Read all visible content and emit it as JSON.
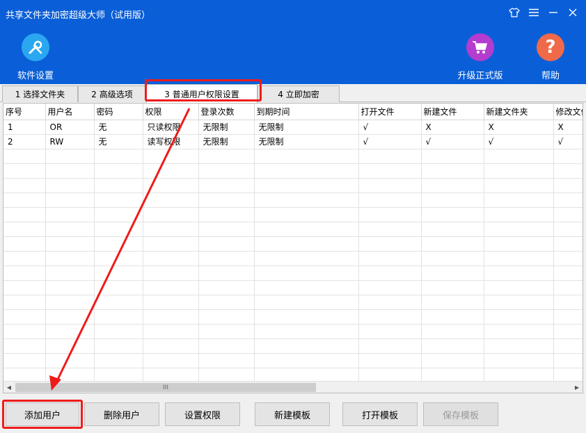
{
  "window": {
    "title": "共享文件夹加密超级大师（试用版）"
  },
  "toolbar": {
    "settings_label": "软件设置",
    "upgrade_label": "升级正式版",
    "help_label": "帮助"
  },
  "tabs": [
    {
      "label": "1 选择文件夹"
    },
    {
      "label": "2 高级选项"
    },
    {
      "label": "3 普通用户权限设置"
    },
    {
      "label": "4 立即加密"
    }
  ],
  "table": {
    "columns": [
      "序号",
      "用户名",
      "密码",
      "权限",
      "登录次数",
      "到期时间",
      "打开文件",
      "新建文件",
      "新建文件夹",
      "修改文件"
    ],
    "rows": [
      [
        "1",
        "OR",
        "无",
        "只读权限",
        "无限制",
        "无限制",
        "√",
        "X",
        "X",
        "X"
      ],
      [
        "2",
        "RW",
        "无",
        "读写权限",
        "无限制",
        "无限制",
        "√",
        "√",
        "√",
        "√"
      ]
    ]
  },
  "scrollbar": {
    "thumb_grip": "III"
  },
  "buttons": {
    "add_user": "添加用户",
    "delete_user": "删除用户",
    "set_permission": "设置权限",
    "new_template": "新建模板",
    "open_template": "打开模板",
    "save_template": "保存模板"
  },
  "colors": {
    "header": "#0a5fd8",
    "highlight": "#ee1b1b"
  }
}
